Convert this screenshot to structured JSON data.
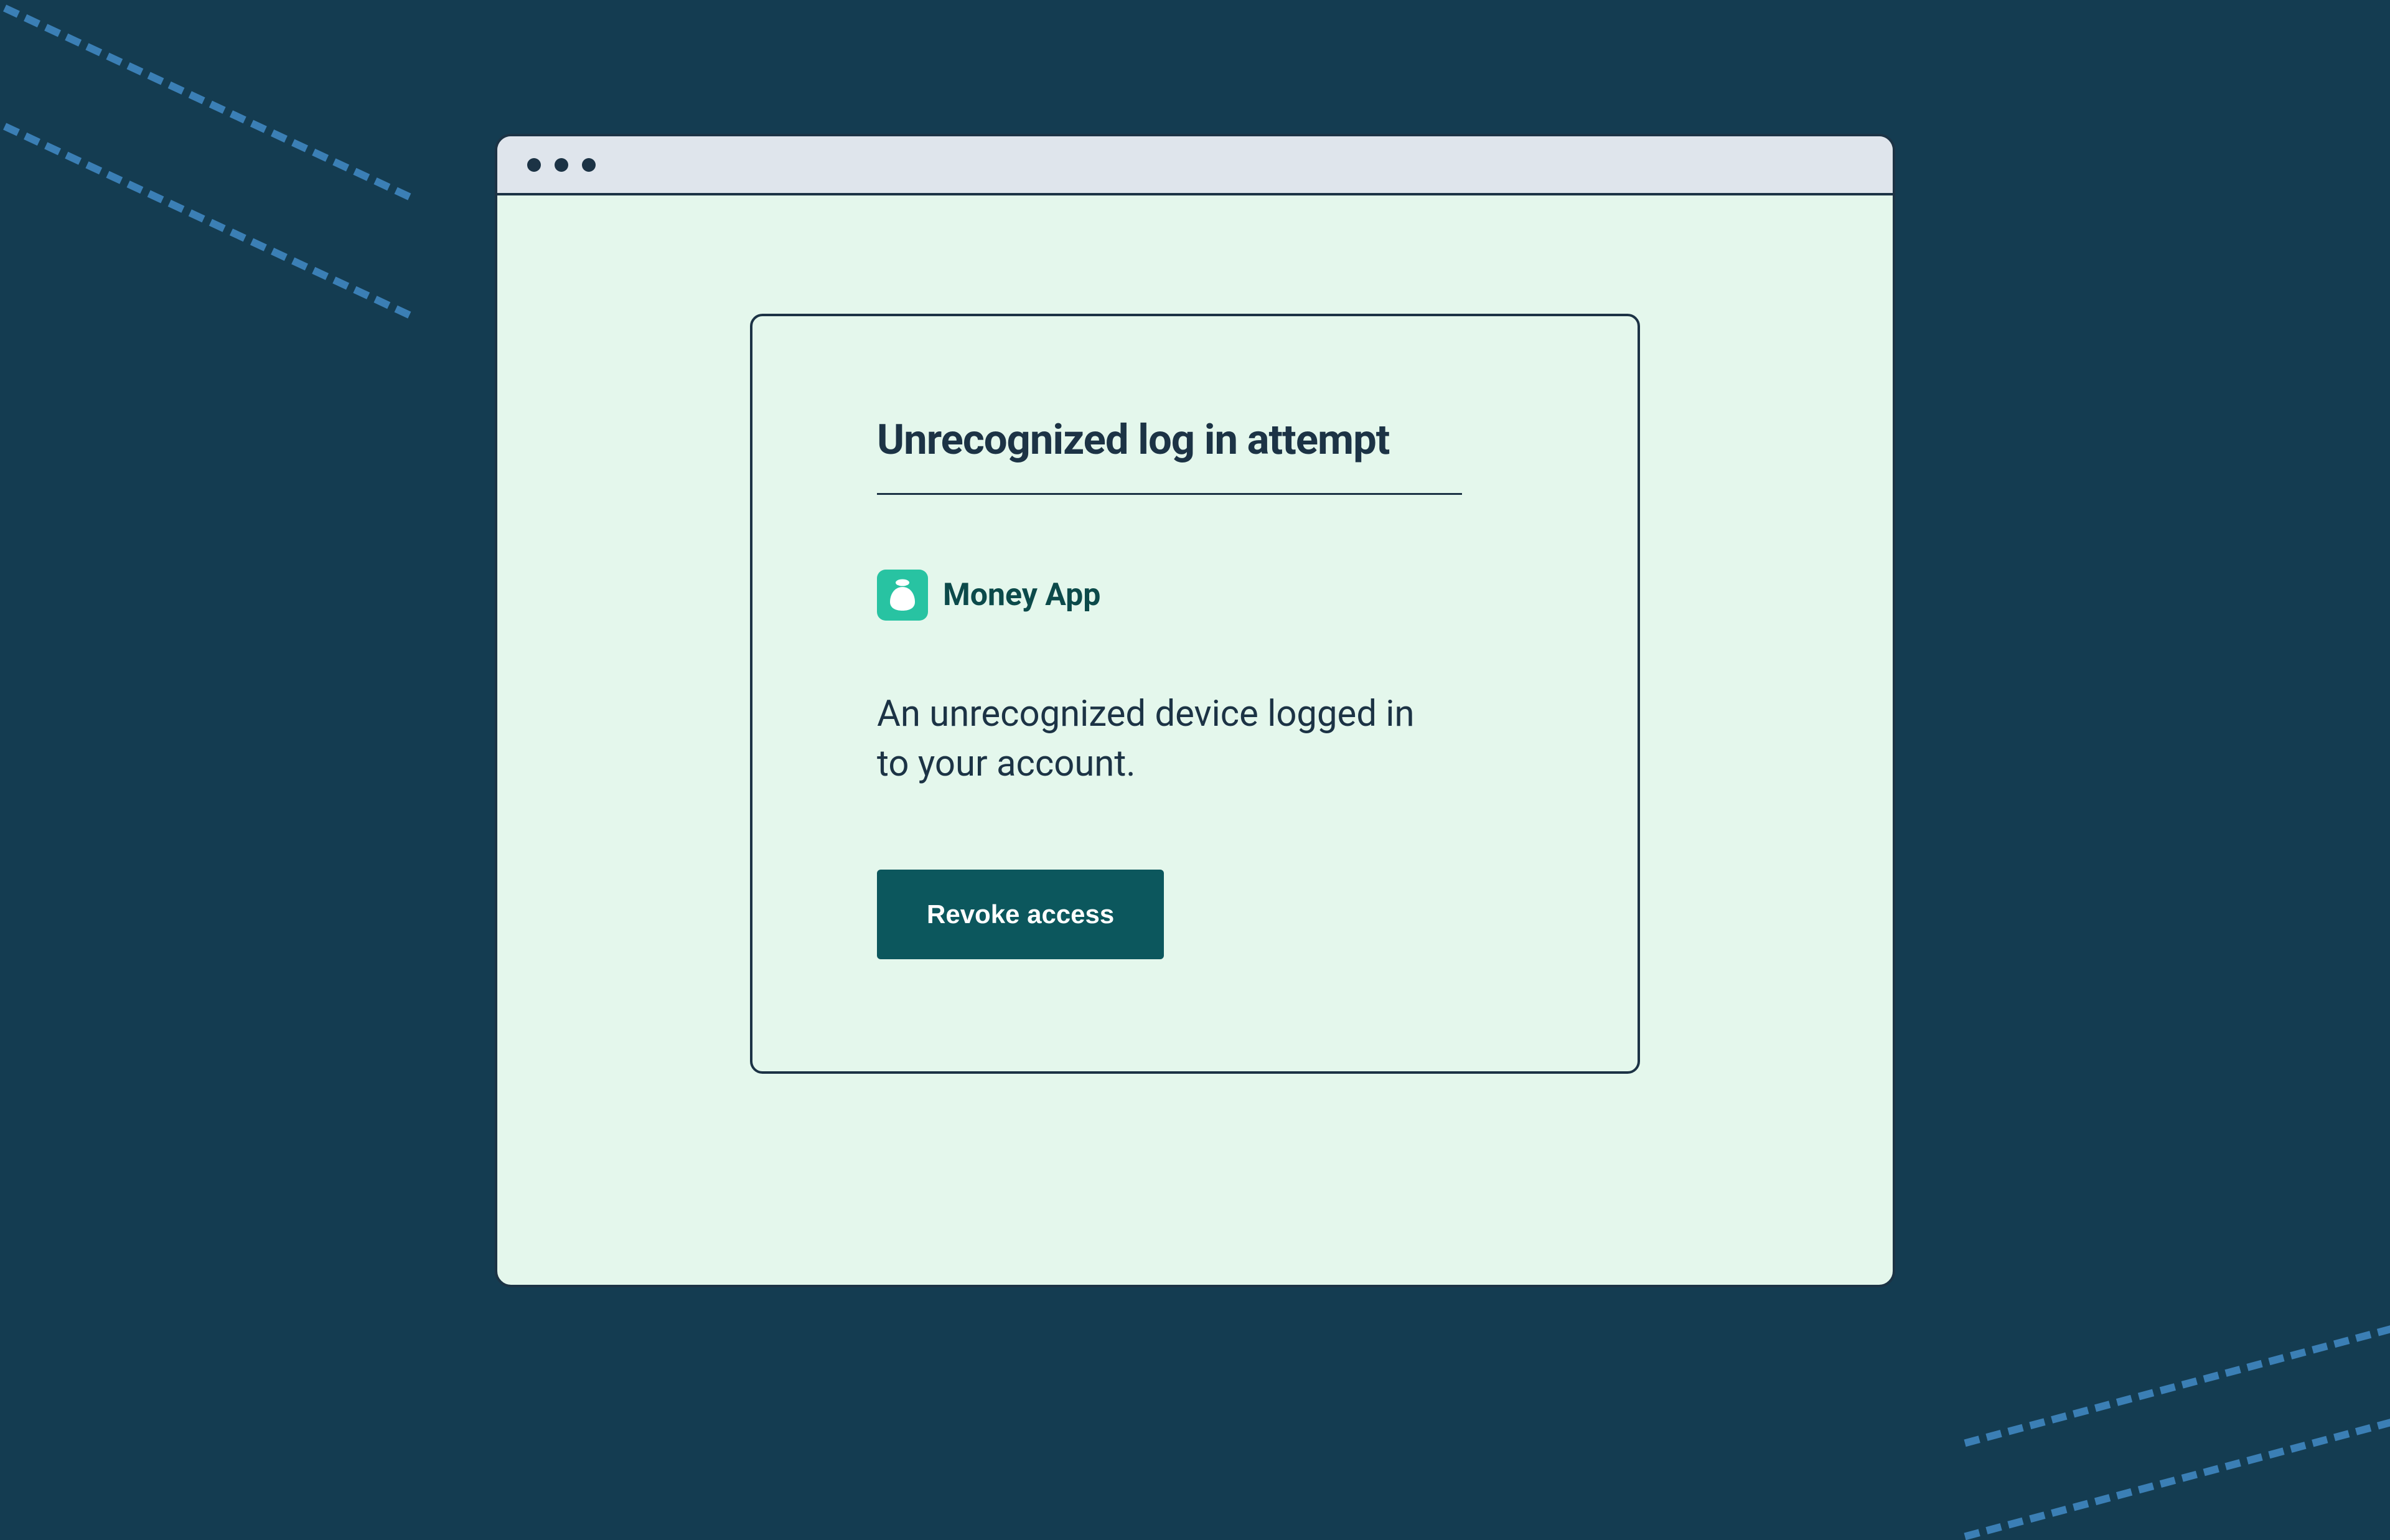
{
  "alert": {
    "title": "Unrecognized log in attempt",
    "app_name": "Money App",
    "message": "An unrecognized device logged in to your account.",
    "button_label": "Revoke access"
  },
  "colors": {
    "background": "#143c51",
    "window_bg": "#e4f7ec",
    "titlebar_bg": "#dfe5ec",
    "border": "#1c3345",
    "accent_icon": "#28c3a2",
    "button_bg": "#0c575d",
    "dash": "#3b7fb5"
  }
}
